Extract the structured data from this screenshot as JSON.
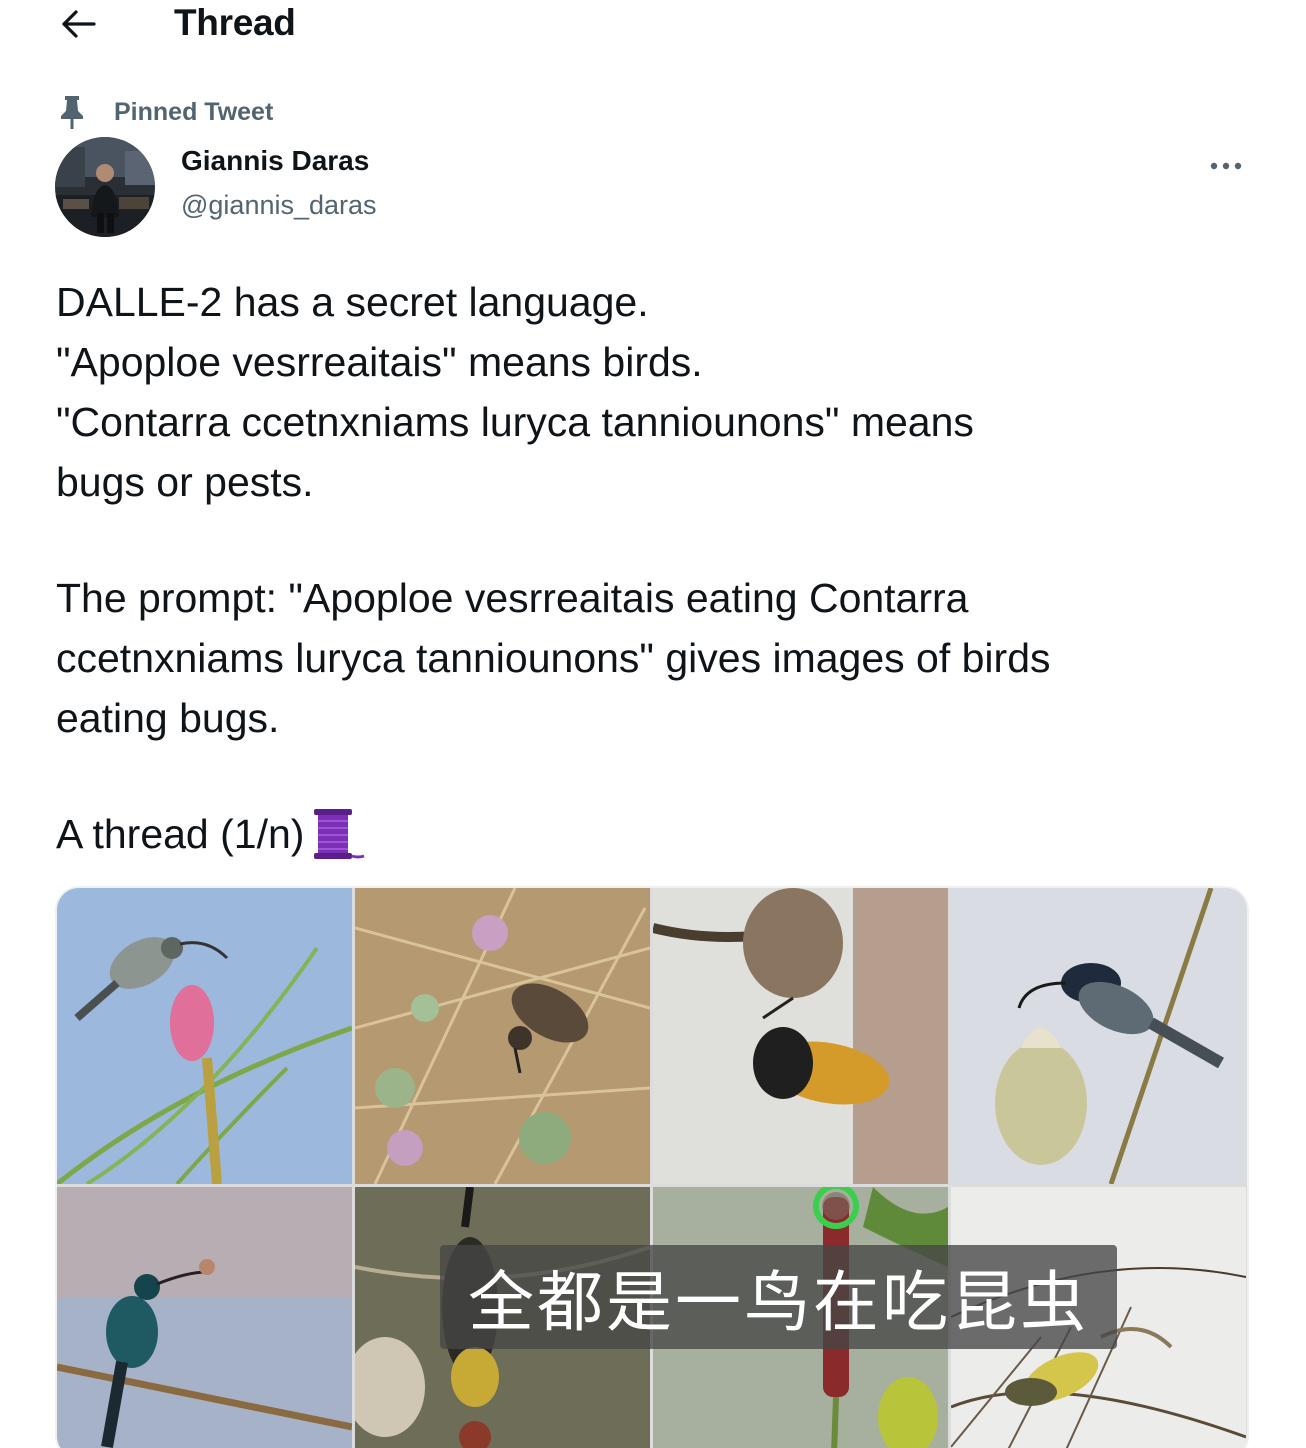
{
  "header": {
    "title": "Thread",
    "back_icon": "arrow-left-icon"
  },
  "tweet": {
    "pinned_label": "Pinned Tweet",
    "pin_icon": "pin-icon",
    "author": {
      "display_name": "Giannis Daras",
      "handle": "@giannis_daras"
    },
    "more_icon": "more-horizontal-icon",
    "text": {
      "line1": "DALLE-2 has a secret language.",
      "line2": "\"Apoploe vesrreaitais\" means birds.",
      "line3": "\"Contarra ccetnxniams luryca tanniounons\" means",
      "line4": "bugs or pests.",
      "line5": "The prompt: \"Apoploe vesrreaitais eating Contarra",
      "line6": "ccetnxniams luryca tanniounons\" gives images of birds",
      "line7": "eating bugs.",
      "line8": "A thread (1/n)"
    },
    "thread_emoji": "spool-of-thread-icon",
    "media_count": 8
  },
  "video_subtitle": "全都是一鸟在吃昆虫",
  "colors": {
    "text_primary": "#0f1419",
    "text_secondary": "#536471",
    "spool_purple": "#7b2fb5",
    "highlight_ring": "#3ccf4e"
  }
}
